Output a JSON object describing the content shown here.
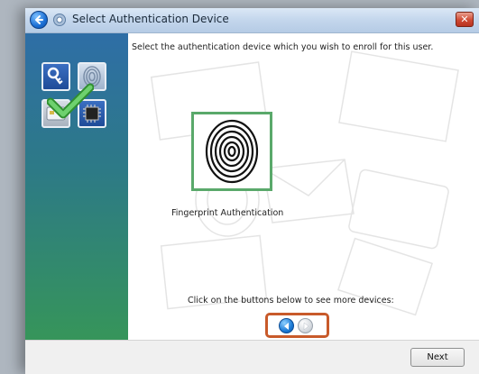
{
  "window": {
    "title": "Select Authentication Device"
  },
  "icons": {
    "back": "back-arrow-icon",
    "app": "gear-icon",
    "close": "close-icon",
    "sidebar_tiles": [
      "key-icon",
      "fingerprint-icon",
      "smartcard-icon",
      "chip-icon"
    ],
    "check": "checkmark-icon"
  },
  "main": {
    "instruction": "Select the authentication device which you wish to enroll for this user.",
    "device_label": "Fingerprint Authentication",
    "more_devices_text": "Click on the buttons below to see more devices:"
  },
  "footer": {
    "next_label": "Next"
  },
  "colors": {
    "selection_frame": "#5aa96b",
    "nav_highlight": "#c85a2a",
    "sidebar_top": "#2e6ea6",
    "sidebar_bottom": "#36955a"
  }
}
